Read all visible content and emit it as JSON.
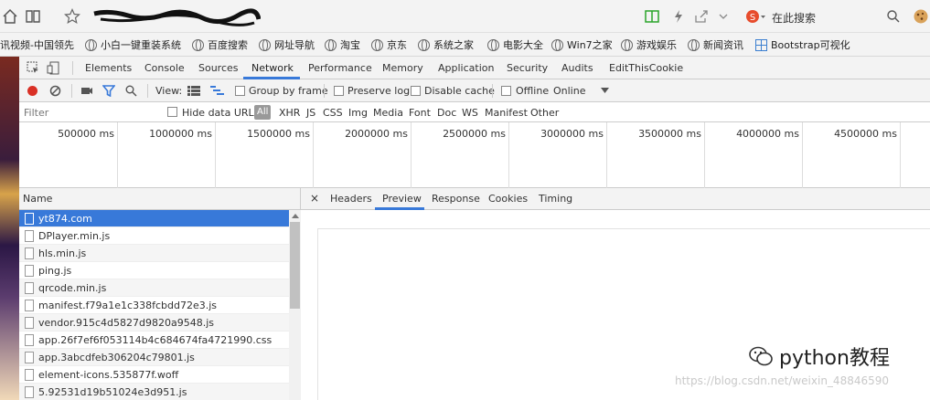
{
  "browser": {
    "address_text": "",
    "search_placeholder": "在此搜索"
  },
  "bookmarks": [
    "讯视频-中国领先",
    "小白一键重装系统",
    "百度搜索",
    "网址导航",
    "淘宝",
    "京东",
    "系统之家",
    "电影大全",
    "Win7之家",
    "游戏娱乐",
    "新闻资讯",
    "Bootstrap可视化"
  ],
  "devtools": {
    "tabs": [
      "Elements",
      "Console",
      "Sources",
      "Network",
      "Performance",
      "Memory",
      "Application",
      "Security",
      "Audits",
      "EditThisCookie"
    ],
    "active_tab": "Network",
    "toolbar": {
      "view_label": "View:",
      "group_by_frame": "Group by frame",
      "preserve_log": "Preserve log",
      "disable_cache": "Disable cache",
      "offline": "Offline",
      "throttle": "Online"
    },
    "filter": {
      "placeholder": "Filter",
      "hide_data_urls": "Hide data URLs",
      "all": "All",
      "types": [
        "XHR",
        "JS",
        "CSS",
        "Img",
        "Media",
        "Font",
        "Doc",
        "WS",
        "Manifest",
        "Other"
      ]
    },
    "timeline_ticks": [
      "500000 ms",
      "1000000 ms",
      "1500000 ms",
      "2000000 ms",
      "2500000 ms",
      "3000000 ms",
      "3500000 ms",
      "4000000 ms",
      "4500000 ms"
    ],
    "name_header": "Name",
    "requests": [
      "yt874.com",
      "DPlayer.min.js",
      "hls.min.js",
      "ping.js",
      "qrcode.min.js",
      "manifest.f79a1e1c338fcbdd72e3.js",
      "vendor.915c4d5827d9820a9548.js",
      "app.26f7ef6f053114b4c684674fa4721990.css",
      "app.3abcdfeb306204c79801.js",
      "element-icons.535877f.woff",
      "5.92531d19b51024e3d951.js"
    ],
    "detail_close": "×",
    "detail_tabs": [
      "Headers",
      "Preview",
      "Response",
      "Cookies",
      "Timing"
    ],
    "active_detail_tab": "Preview"
  },
  "watermark": {
    "text": "python教程",
    "url": "https://blog.csdn.net/weixin_48846590"
  }
}
